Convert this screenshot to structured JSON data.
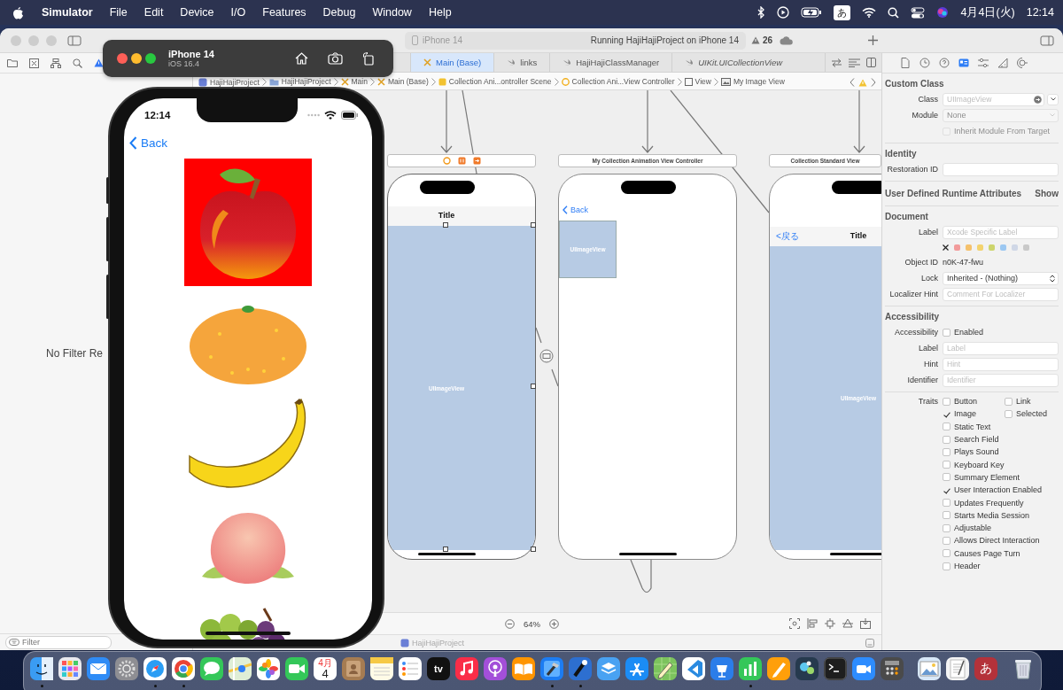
{
  "menu_bar": {
    "app": "Simulator",
    "menus": [
      "File",
      "Edit",
      "Device",
      "I/O",
      "Features",
      "Debug",
      "Window",
      "Help"
    ],
    "input_source": "あ",
    "date": "4月4日(火)",
    "time": "12:14"
  },
  "xcode": {
    "activity": {
      "device": "iPhone 14",
      "status": "Running HajiHajiProject on iPhone 14",
      "warnings": "26"
    },
    "navigator": {
      "empty_message": "No Filter Re",
      "filter": {
        "placeholder": "Filter"
      }
    },
    "tabs": [
      {
        "label": "Main (Base)",
        "kind": "storyboard",
        "selected": true,
        "preview": false
      },
      {
        "label": "links",
        "kind": "swift",
        "selected": false,
        "preview": false
      },
      {
        "label": "HajiHajiClassManager",
        "kind": "swift",
        "selected": false,
        "preview": false
      },
      {
        "label": "UIKit.UICollectionView",
        "kind": "swift",
        "selected": false,
        "preview": true
      }
    ],
    "jump_bar": [
      {
        "label": "HajiHajiProject",
        "kind": "project"
      },
      {
        "label": "HajiHajiProject",
        "kind": "folder"
      },
      {
        "label": "Main",
        "kind": "storyboard"
      },
      {
        "label": "Main (Base)",
        "kind": "storyboard"
      },
      {
        "label": "Collection Ani...ontroller Scene",
        "kind": "scene"
      },
      {
        "label": "Collection Ani...View Controller",
        "kind": "controller"
      },
      {
        "label": "View",
        "kind": "view"
      },
      {
        "label": "My Image View",
        "kind": "image"
      }
    ],
    "scenes": [
      {
        "nav_title": "Title",
        "image_label": "UIImageView",
        "kind": "full",
        "selected": true
      },
      {
        "header": "My Collection Animation View Controller",
        "back": "Back",
        "image_label": "UIImageView",
        "kind": "thumb",
        "selected": false
      },
      {
        "header": "Collection Standard View",
        "back": "<戻る",
        "nav_title": "Title",
        "image_label": "UIImageView",
        "kind": "full",
        "selected": false
      }
    ],
    "zoom": "64%",
    "status_project": "HajiHajiProject",
    "inspector": {
      "tabs": [
        {
          "kind": "file",
          "selected": false
        },
        {
          "kind": "history",
          "selected": false
        },
        {
          "kind": "help",
          "selected": false
        },
        {
          "kind": "identity",
          "selected": true
        },
        {
          "kind": "attributes",
          "selected": false
        },
        {
          "kind": "size",
          "selected": false
        },
        {
          "kind": "connections",
          "selected": false
        }
      ],
      "custom_class": {
        "title": "Custom Class",
        "class_field": {
          "label": "Class",
          "placeholder": "UIImageView"
        },
        "module_label": "Module",
        "module_value": "None",
        "module_disabled": true,
        "inherit": {
          "label": "Inherit Module From Target",
          "checked": false,
          "disabled": true
        }
      },
      "identity": {
        "title": "Identity",
        "restoration_label": "Restoration ID"
      },
      "runtime": {
        "title": "User Defined Runtime Attributes",
        "action": "Show"
      },
      "document": {
        "title": "Document",
        "label_field": {
          "label": "Label",
          "placeholder": "Xcode Specific Label"
        },
        "colors": [
          {
            "color": "#f29b9b"
          },
          {
            "color": "#f5c16c"
          },
          {
            "color": "#f3d36e"
          },
          {
            "color": "#cdd56c"
          },
          {
            "color": "#9cc8f2"
          },
          {
            "color": "#cfd7e6"
          },
          {
            "color": "#c9c9c9"
          }
        ],
        "object_id_label": "Object ID",
        "object_id": "n0K-47-fwu",
        "lock_label": "Lock",
        "lock_value": "Inherited - (Nothing)",
        "hint_field": {
          "label": "Localizer Hint",
          "placeholder": "Comment For Localizer"
        }
      },
      "accessibility": {
        "title": "Accessibility",
        "enabled_label": "Accessibility",
        "enabled": {
          "label": "Enabled",
          "checked": false
        },
        "fields": [
          {
            "label": "Label",
            "placeholder": "Label"
          },
          {
            "label": "Hint",
            "placeholder": "Hint"
          },
          {
            "label": "Identifier",
            "placeholder": "Identifier"
          }
        ],
        "traits_label": "Traits",
        "traits": [
          [
            {
              "label": "Button",
              "checked": false
            },
            {
              "label": "Link",
              "checked": false
            }
          ],
          [
            {
              "label": "Image",
              "checked": true
            },
            {
              "label": "Selected",
              "checked": false
            }
          ],
          [
            {
              "label": "Static Text",
              "checked": false
            }
          ],
          [
            {
              "label": "Search Field",
              "checked": false
            }
          ],
          [
            {
              "label": "Plays Sound",
              "checked": false
            }
          ],
          [
            {
              "label": "Keyboard Key",
              "checked": false
            }
          ],
          [
            {
              "label": "Summary Element",
              "checked": false
            }
          ],
          [
            {
              "label": "User Interaction Enabled",
              "checked": true
            }
          ],
          [
            {
              "label": "Updates Frequently",
              "checked": false
            }
          ],
          [
            {
              "label": "Starts Media Session",
              "checked": false
            }
          ],
          [
            {
              "label": "Adjustable",
              "checked": false
            }
          ],
          [
            {
              "label": "Allows Direct Interaction",
              "checked": false
            }
          ],
          [
            {
              "label": "Causes Page Turn",
              "checked": false
            }
          ],
          [
            {
              "label": "Header",
              "checked": false
            }
          ]
        ]
      }
    }
  },
  "simulator": {
    "device": "iPhone 14",
    "os": "iOS 16.4",
    "time": "12:14",
    "back": "Back",
    "images": [
      {
        "kind": "apple"
      },
      {
        "kind": "orange"
      },
      {
        "kind": "banana"
      },
      {
        "kind": "peach"
      },
      {
        "kind": "grapes"
      }
    ]
  },
  "dock": [
    [
      {
        "kind": "finder",
        "running": true
      },
      {
        "kind": "launchpad",
        "running": false
      },
      {
        "kind": "mail",
        "running": false
      },
      {
        "kind": "settings",
        "running": false
      },
      {
        "kind": "safari",
        "running": true
      },
      {
        "kind": "chrome",
        "running": true
      },
      {
        "kind": "messages",
        "running": false
      },
      {
        "kind": "maps",
        "running": false
      },
      {
        "kind": "photos",
        "running": false
      },
      {
        "kind": "facetime",
        "running": false
      },
      {
        "kind": "calendar",
        "month": "4月",
        "day": "4",
        "running": false
      },
      {
        "kind": "contacts",
        "running": false
      },
      {
        "kind": "notes",
        "running": false
      },
      {
        "kind": "reminders",
        "running": false
      },
      {
        "kind": "tv",
        "label": "tv",
        "running": false
      },
      {
        "kind": "music",
        "running": false
      },
      {
        "kind": "podcasts",
        "running": false
      },
      {
        "kind": "books",
        "running": false
      },
      {
        "kind": "xcode",
        "running": true
      },
      {
        "kind": "instruments",
        "running": true
      },
      {
        "kind": "simulator",
        "running": false
      },
      {
        "kind": "appstore",
        "running": false
      },
      {
        "kind": "sketch",
        "running": false
      },
      {
        "kind": "vscode",
        "running": false
      },
      {
        "kind": "keynote",
        "running": false
      },
      {
        "kind": "numbers",
        "running": true
      },
      {
        "kind": "pages",
        "running": false
      },
      {
        "kind": "bug",
        "running": false
      },
      {
        "kind": "terminal",
        "running": false
      },
      {
        "kind": "zoom",
        "running": false
      },
      {
        "kind": "calculator",
        "running": false
      }
    ],
    [
      {
        "kind": "preview",
        "running": false
      },
      {
        "kind": "textedit",
        "running": false
      },
      {
        "kind": "dictionary",
        "label": "あ",
        "running": false
      }
    ],
    [
      {
        "kind": "trash",
        "running": false
      }
    ]
  ]
}
